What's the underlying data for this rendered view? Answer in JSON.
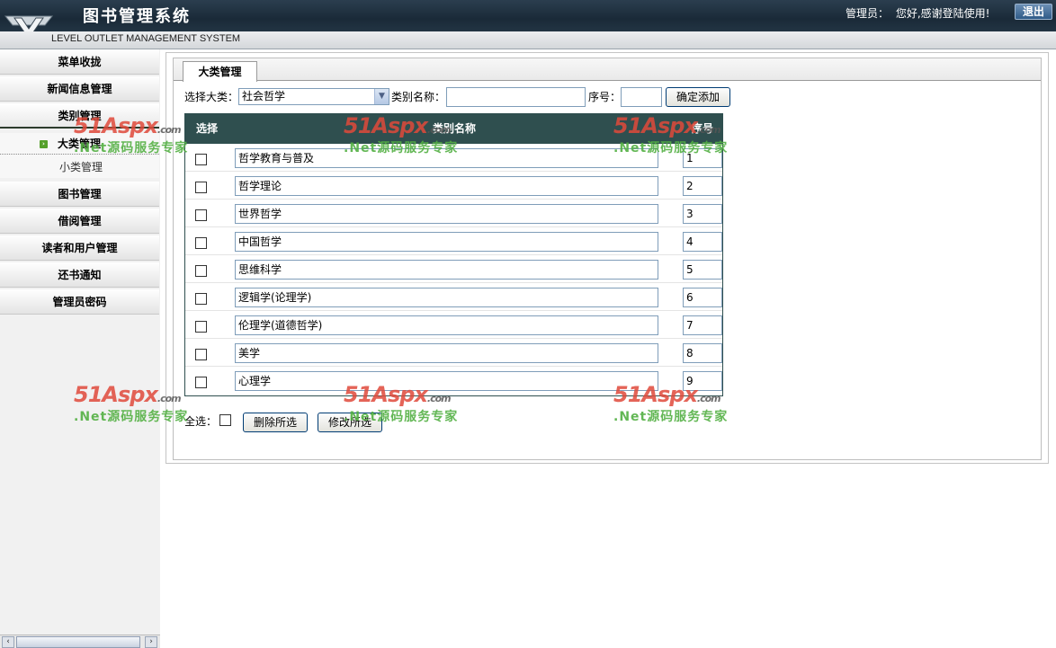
{
  "header": {
    "app_title": "图书管理系统",
    "subtitle": "LEVEL OUTLET MANAGEMENT SYSTEM",
    "admin_label": "管理员：",
    "greeting": "您好,感谢登陆使用!",
    "exit_label": "退出"
  },
  "sidebar": {
    "items": [
      {
        "label": "菜单收拢"
      },
      {
        "label": "新闻信息管理"
      },
      {
        "label": "类别管理"
      },
      {
        "label": "图书管理"
      },
      {
        "label": "借阅管理"
      },
      {
        "label": "读者和用户管理"
      },
      {
        "label": "还书通知"
      },
      {
        "label": "管理员密码"
      }
    ],
    "submenu": [
      {
        "label": "大类管理"
      },
      {
        "label": "小类管理"
      }
    ]
  },
  "tab": {
    "label": "大类管理"
  },
  "form": {
    "select_label": "选择大类：",
    "select_value": "社会哲学",
    "name_label": "类别名称：",
    "name_value": "",
    "order_label": "序号：",
    "order_value": "",
    "add_button": "确定添加"
  },
  "table": {
    "headers": [
      "选择",
      "类别名称",
      "序号"
    ],
    "rows": [
      {
        "name": "哲学教育与普及",
        "order": "1"
      },
      {
        "name": "哲学理论",
        "order": "2"
      },
      {
        "name": "世界哲学",
        "order": "3"
      },
      {
        "name": "中国哲学",
        "order": "4"
      },
      {
        "name": "思维科学",
        "order": "5"
      },
      {
        "name": "逻辑学(论理学)",
        "order": "6"
      },
      {
        "name": "伦理学(道德哲学)",
        "order": "7"
      },
      {
        "name": "美学",
        "order": "8"
      },
      {
        "name": "心理学",
        "order": "9"
      }
    ]
  },
  "footer": {
    "select_all_label": "全选：",
    "delete_button": "删除所选",
    "modify_button": "修改所选"
  },
  "watermark": {
    "logo": "51Aspx",
    "domain": ".com",
    "tagline": ".Net源码服务专家"
  }
}
